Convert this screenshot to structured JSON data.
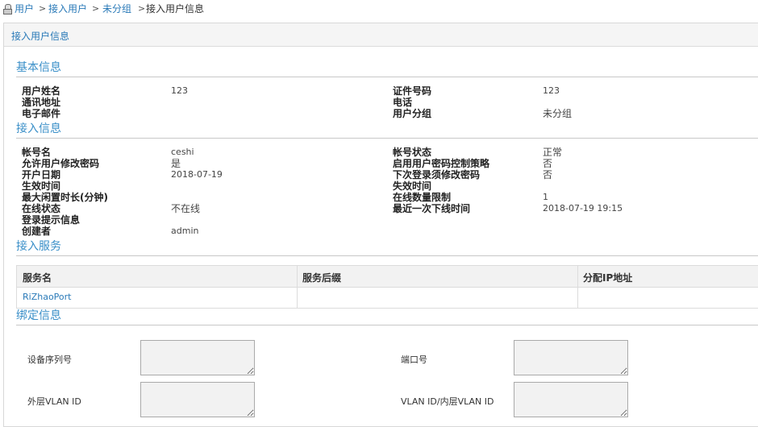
{
  "breadcrumb": {
    "items": [
      "用户",
      "接入用户",
      "未分组"
    ],
    "separator": ">",
    "current": "接入用户信息"
  },
  "panel": {
    "title": "接入用户信息"
  },
  "basic": {
    "title": "基本信息",
    "user_name_label": "用户姓名",
    "user_name": "123",
    "address_label": "通讯地址",
    "address": "",
    "email_label": "电子邮件",
    "email": "",
    "id_number_label": "证件号码",
    "id_number": "123",
    "phone_label": "电话",
    "phone": "",
    "group_label": "用户分组",
    "group": "未分组"
  },
  "access": {
    "title": "接入信息",
    "account_label": "帐号名",
    "account": "ceshi",
    "allow_pwd_change_label": "允许用户修改密码",
    "allow_pwd_change": "是",
    "open_date_label": "开户日期",
    "open_date": "2018-07-19",
    "effective_time_label": "生效时间",
    "effective_time": "",
    "max_idle_label": "最大闲置时长(分钟)",
    "max_idle": "",
    "online_status_label": "在线状态",
    "online_status": "不在线",
    "login_tip_label": "登录提示信息",
    "login_tip": "",
    "creator_label": "创建者",
    "creator": "admin",
    "account_status_label": "帐号状态",
    "account_status": "正常",
    "pwd_policy_label": "启用用户密码控制策略",
    "pwd_policy": "否",
    "next_login_change_label": "下次登录须修改密码",
    "next_login_change": "否",
    "expire_time_label": "失效时间",
    "expire_time": "",
    "online_limit_label": "在线数量限制",
    "online_limit": "1",
    "last_offline_label": "最近一次下线时间",
    "last_offline": "2018-07-19 19:15"
  },
  "service": {
    "title": "接入服务",
    "columns": [
      "服务名",
      "服务后缀",
      "分配IP地址"
    ],
    "rows": [
      {
        "name": "RiZhaoPort",
        "suffix": "",
        "ip": ""
      }
    ]
  },
  "binding": {
    "title": "绑定信息",
    "device_serial_label": "设备序列号",
    "device_serial": "",
    "port_label": "端口号",
    "port": "",
    "outer_vlan_label": "外层VLAN ID",
    "outer_vlan": "",
    "inner_vlan_label": "VLAN ID/内层VLAN ID",
    "inner_vlan": ""
  },
  "colors": {
    "link": "#2a7ab8",
    "section": "#3a8fc8"
  }
}
